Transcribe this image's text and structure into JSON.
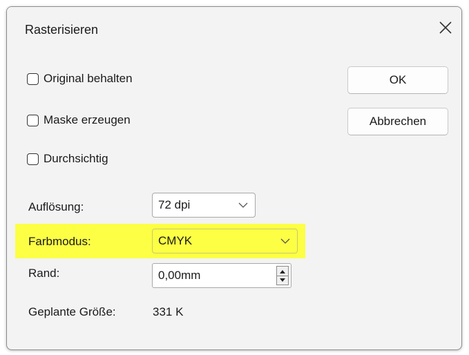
{
  "dialog": {
    "title": "Rasterisieren",
    "close_icon": "close-icon"
  },
  "options": {
    "keep_original": "Original behalten",
    "create_mask": "Maske erzeugen",
    "transparent": "Durchsichtig"
  },
  "buttons": {
    "ok": "OK",
    "cancel": "Abbrechen"
  },
  "fields": {
    "resolution_label": "Auflösung:",
    "resolution_value": "72 dpi",
    "color_mode_label": "Farbmodus:",
    "color_mode_value": "CMYK",
    "margin_label": "Rand:",
    "margin_value": "0,00mm",
    "planned_size_label": "Geplante Größe:",
    "planned_size_value": "331 K"
  },
  "colors": {
    "highlight": "#fcff44",
    "dialog_bg": "#f3f3f3"
  }
}
